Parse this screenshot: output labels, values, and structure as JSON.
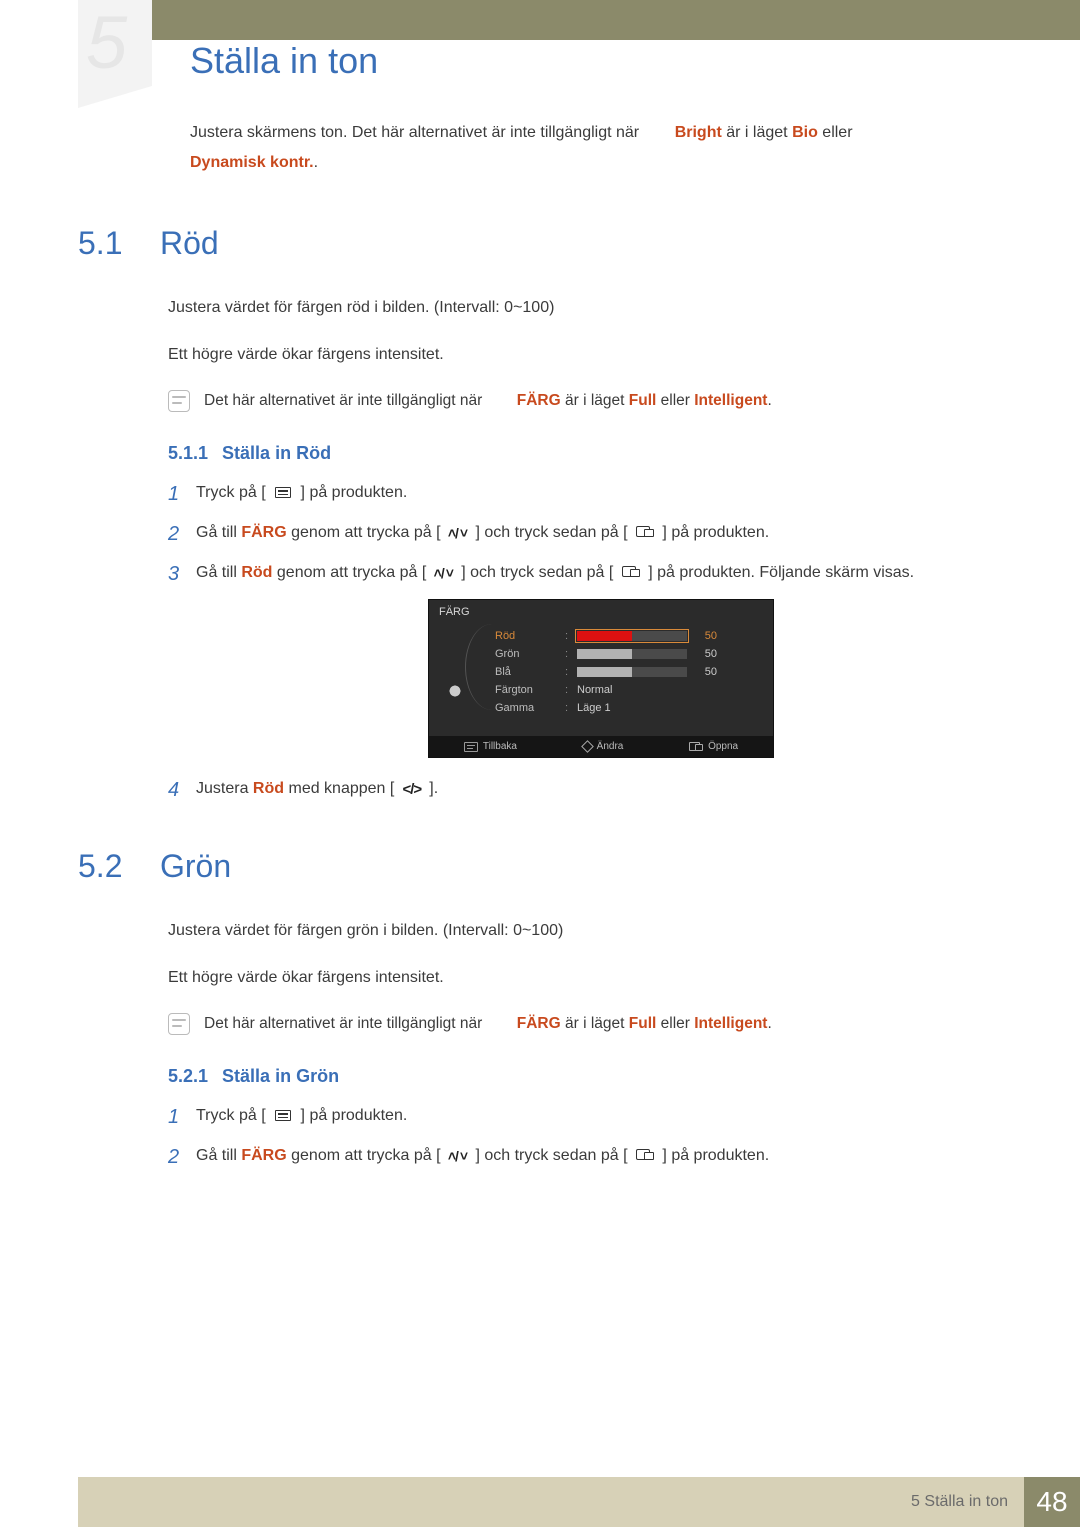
{
  "chapter": {
    "number": "5",
    "title": "Ställa in ton"
  },
  "intro": {
    "lead": "Justera skärmens ton. Det här alternativet är inte tillgängligt när",
    "bright_word": "Bright",
    "mid1": " är i läget ",
    "bio_word": "Bio",
    "mid2": " eller ",
    "dynamisk": "Dynamisk kontr.",
    "tail": "."
  },
  "sections": {
    "rod": {
      "num": "5.1",
      "title": "Röd",
      "desc": "Justera värdet för färgen röd i bilden. (Intervall: 0~100)",
      "desc2": "Ett högre värde ökar färgens intensitet.",
      "note": {
        "pre": "Det här alternativet är inte tillgängligt när",
        "farg": "FÄRG",
        "mid": " är i läget ",
        "full": "Full",
        "or": " eller ",
        "intel": "Intelligent",
        "post": "."
      },
      "sub": {
        "num": "5.1.1",
        "title": "Ställa in Röd"
      },
      "steps": {
        "s1_a": "Tryck på [",
        "s1_b": "] på produkten.",
        "s2_a": "Gå till ",
        "s2_farg": "FÄRG",
        "s2_b": " genom att trycka på [",
        "s2_c": "] och tryck sedan på [",
        "s2_d": "] på produkten.",
        "s3_a": "Gå till ",
        "s3_rod": "Röd",
        "s3_b": " genom att trycka på [",
        "s3_c": "] och tryck sedan på [",
        "s3_d": "] på produkten. Följande skärm visas.",
        "s4_a": "Justera ",
        "s4_rod": "Röd",
        "s4_b": " med knappen [",
        "s4_c": "]."
      }
    },
    "gron": {
      "num": "5.2",
      "title": "Grön",
      "desc": "Justera värdet för färgen grön i bilden. (Intervall: 0~100)",
      "desc2": "Ett högre värde ökar färgens intensitet.",
      "note": {
        "pre": "Det här alternativet är inte tillgängligt när",
        "farg": "FÄRG",
        "mid": " är i läget ",
        "full": "Full",
        "or": " eller ",
        "intel": "Intelligent",
        "post": "."
      },
      "sub": {
        "num": "5.2.1",
        "title": "Ställa in Grön"
      },
      "steps": {
        "s1_a": "Tryck på [",
        "s1_b": "] på produkten.",
        "s2_a": "Gå till ",
        "s2_farg": "FÄRG",
        "s2_b": " genom att trycka på [",
        "s2_c": "] och tryck sedan på [",
        "s2_d": "] på produkten."
      }
    }
  },
  "osd": {
    "title": "FÄRG",
    "rows": {
      "rod": {
        "label": "Röd",
        "value": 50
      },
      "gron": {
        "label": "Grön",
        "value": 50
      },
      "bla": {
        "label": "Blå",
        "value": 50
      },
      "fargton": {
        "label": "Färgton",
        "text": "Normal"
      },
      "gamma": {
        "label": "Gamma",
        "text": "Läge 1"
      }
    },
    "footer": {
      "back": "Tillbaka",
      "change": "Ändra",
      "open": "Öppna"
    }
  },
  "footer": {
    "section_label_num": "5",
    "section_label": "Ställa in ton",
    "page": "48"
  }
}
